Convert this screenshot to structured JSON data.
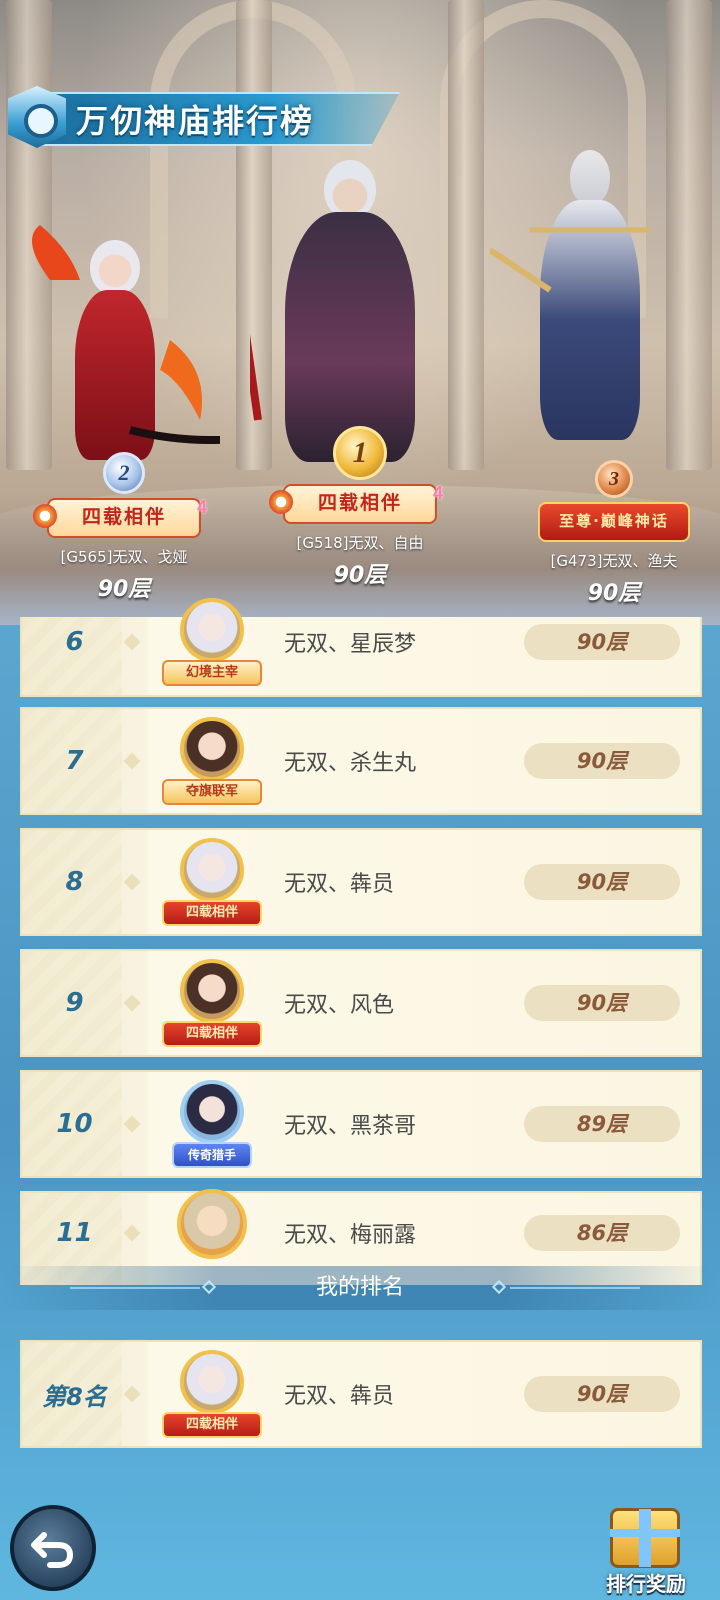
{
  "header": {
    "title": "万仞神庙排行榜"
  },
  "podium": [
    {
      "rank": "2",
      "banner": "四载相伴",
      "banner_style": "gold",
      "name": "[G565]无双、戈娅",
      "floor": "90层"
    },
    {
      "rank": "1",
      "banner": "四载相伴",
      "banner_style": "gold",
      "name": "[G518]无双、自由",
      "floor": "90层"
    },
    {
      "rank": "3",
      "banner": "至尊·巅峰神话",
      "banner_style": "red",
      "name": "[G473]无双、渔夫",
      "floor": "90层"
    }
  ],
  "list": [
    {
      "rank": "6",
      "tag": "幻境主宰",
      "tag_style": "gold",
      "name": "无双、星辰梦",
      "floor": "90层"
    },
    {
      "rank": "7",
      "tag": "夺旗联军",
      "tag_style": "gold",
      "name": "无双、杀生丸",
      "floor": "90层"
    },
    {
      "rank": "8",
      "tag": "四载相伴",
      "tag_style": "red",
      "name": "无双、犇员",
      "floor": "90层"
    },
    {
      "rank": "9",
      "tag": "四载相伴",
      "tag_style": "red",
      "name": "无双、风色",
      "floor": "90层"
    },
    {
      "rank": "10",
      "tag": "传奇猎手",
      "tag_style": "blue",
      "name": "无双、黑茶哥",
      "floor": "89层"
    },
    {
      "rank": "11",
      "tag": "",
      "tag_style": "none",
      "name": "无双、梅丽露",
      "floor": "86层"
    }
  ],
  "my_rank": {
    "header": "我的排名",
    "rank": "第8名",
    "tag": "四载相伴",
    "name": "无双、犇员",
    "floor": "90层"
  },
  "buttons": {
    "back_icon": "back-arrow-icon",
    "reward_label": "排行奖励",
    "reward_icon": "gift-box-icon"
  }
}
